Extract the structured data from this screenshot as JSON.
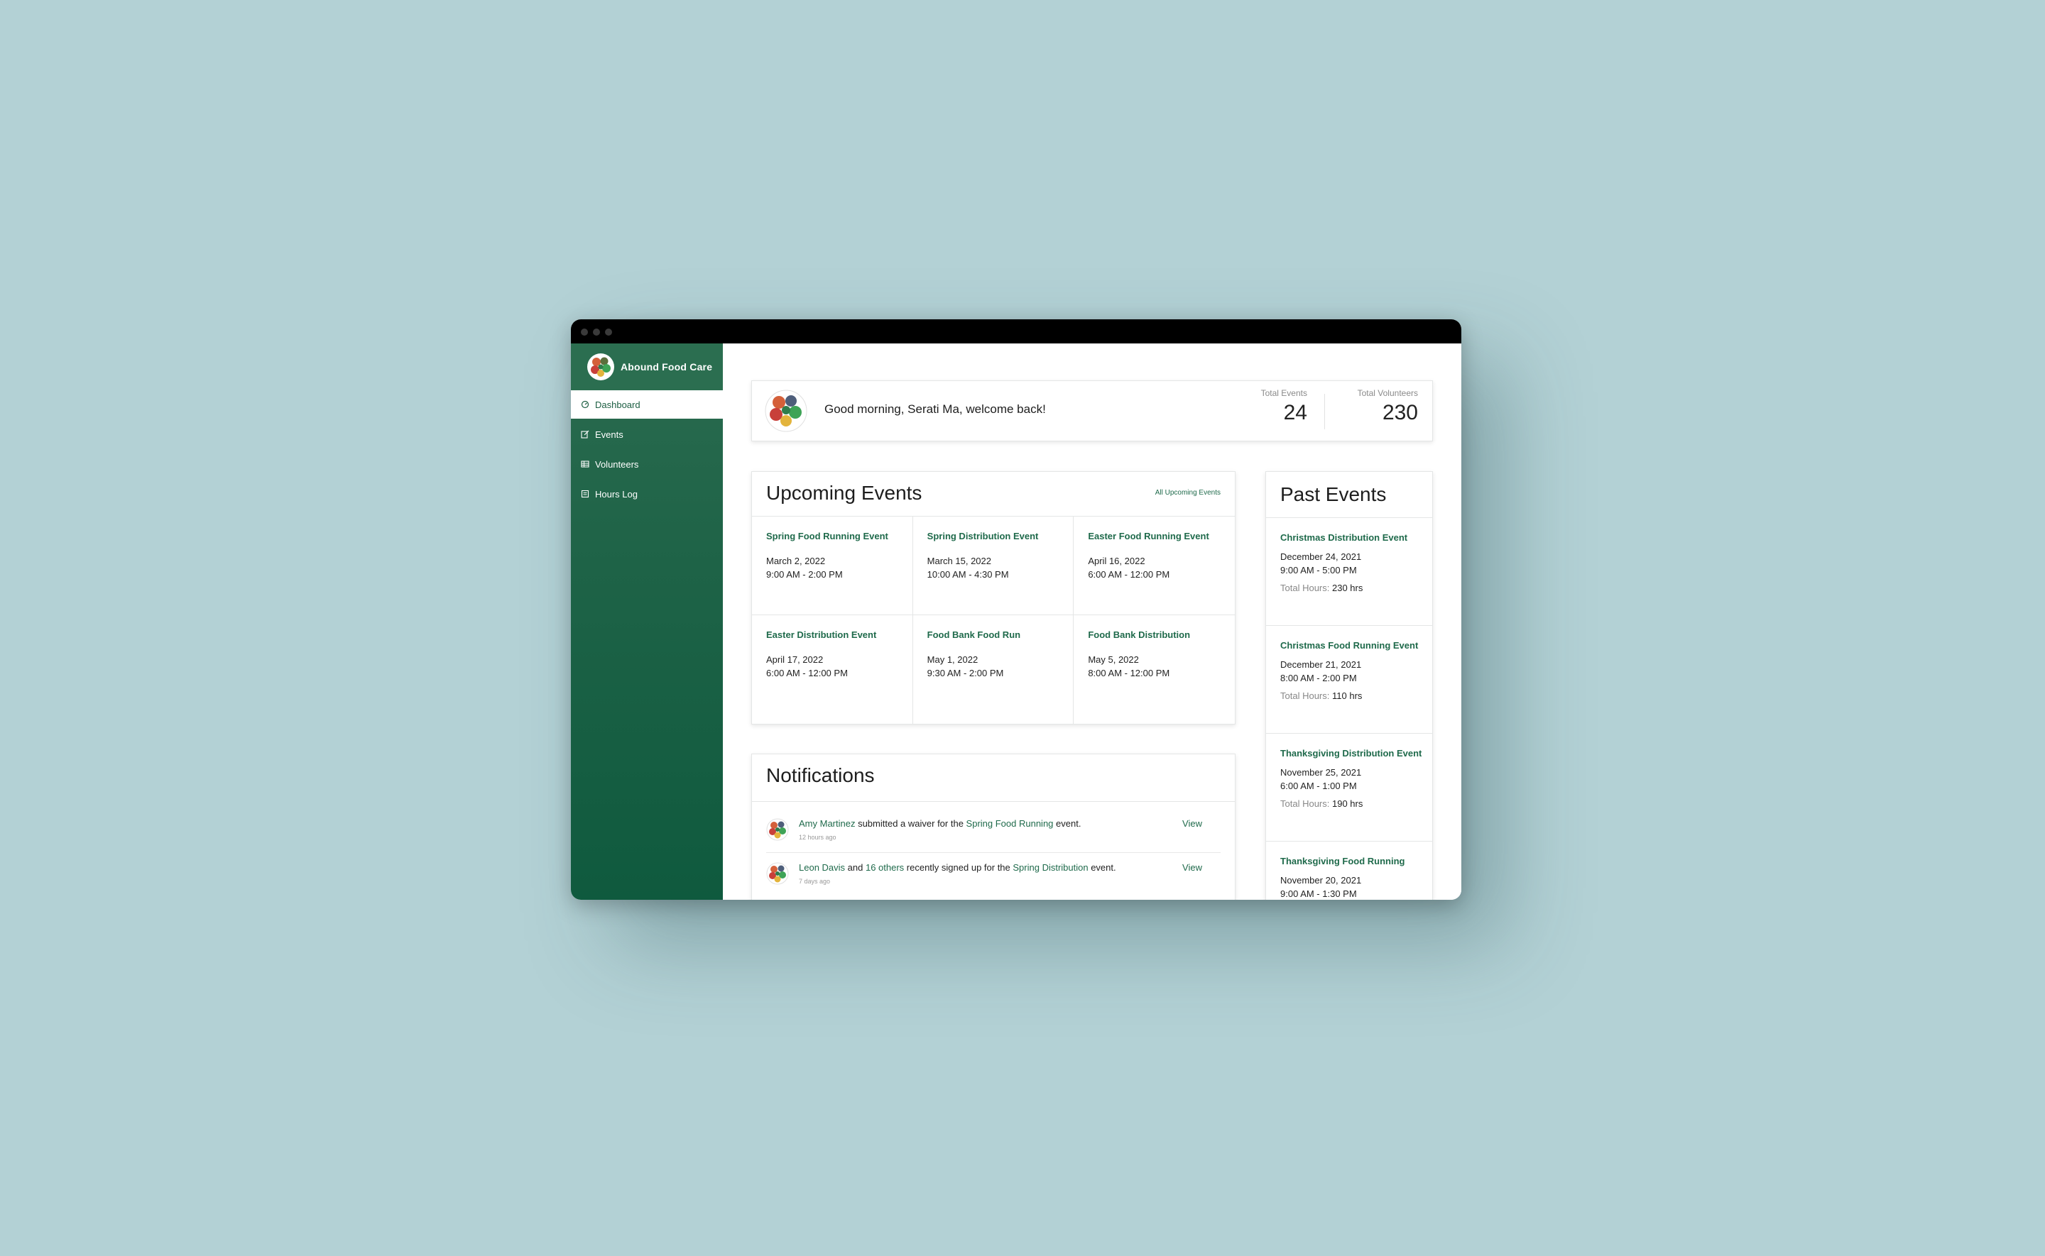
{
  "app": {
    "name": "Abound Food Care"
  },
  "sidebar": {
    "items": [
      {
        "label": "Dashboard",
        "icon": "dashboard-icon",
        "active": true
      },
      {
        "label": "Events",
        "icon": "edit-icon",
        "active": false
      },
      {
        "label": "Volunteers",
        "icon": "table-icon",
        "active": false
      },
      {
        "label": "Hours Log",
        "icon": "log-icon",
        "active": false
      }
    ]
  },
  "welcome": {
    "greeting": "Good morning, Serati Ma, welcome back!",
    "total_events_label": "Total Events",
    "total_events_value": "24",
    "total_volunteers_label": "Total Volunteers",
    "total_volunteers_value": "230"
  },
  "upcoming": {
    "title": "Upcoming Events",
    "link": "All Upcoming Events",
    "events": [
      {
        "name": "Spring Food Running Event",
        "date": "March 2, 2022",
        "time": "9:00 AM - 2:00 PM"
      },
      {
        "name": "Spring Distribution Event",
        "date": "March 15, 2022",
        "time": "10:00 AM - 4:30 PM"
      },
      {
        "name": "Easter Food Running Event",
        "date": "April 16, 2022",
        "time": "6:00 AM - 12:00 PM"
      },
      {
        "name": "Easter Distribution Event",
        "date": "April 17, 2022",
        "time": "6:00 AM - 12:00 PM"
      },
      {
        "name": "Food Bank Food Run",
        "date": "May 1, 2022",
        "time": "9:30 AM - 2:00 PM"
      },
      {
        "name": "Food Bank Distribution",
        "date": "May 5, 2022",
        "time": "8:00 AM - 12:00 PM"
      }
    ]
  },
  "notifications": {
    "title": "Notifications",
    "items": [
      {
        "user": "Amy Martinez",
        "text_a": " submitted a waiver for the ",
        "event": "Spring Food Running",
        "text_b": " event.",
        "time": "12 hours ago",
        "action": "View"
      },
      {
        "user": "Leon Davis",
        "text_and": " and ",
        "others": "16 others",
        "text_a": " recently signed up for the ",
        "event": "Spring Distribution",
        "text_b": " event.",
        "time": "7 days ago",
        "action": "View"
      }
    ]
  },
  "past": {
    "title": "Past Events",
    "hours_label": "Total Hours:",
    "events": [
      {
        "name": "Christmas Distribution Event",
        "date": "December 24, 2021",
        "time": "9:00 AM - 5:00 PM",
        "hours": "230 hrs"
      },
      {
        "name": "Christmas Food Running Event",
        "date": "December 21, 2021",
        "time": "8:00 AM - 2:00 PM",
        "hours": "110 hrs"
      },
      {
        "name": "Thanksgiving Distribution Event",
        "date": "November 25, 2021",
        "time": "6:00 AM - 1:00 PM",
        "hours": "190 hrs"
      },
      {
        "name": "Thanksgiving Food Running",
        "date": "November 20, 2021",
        "time": "9:00 AM - 1:30 PM",
        "hours": ""
      }
    ]
  },
  "colors": {
    "brand_green": "#1f6a4b",
    "background": "#b3d1d5"
  }
}
